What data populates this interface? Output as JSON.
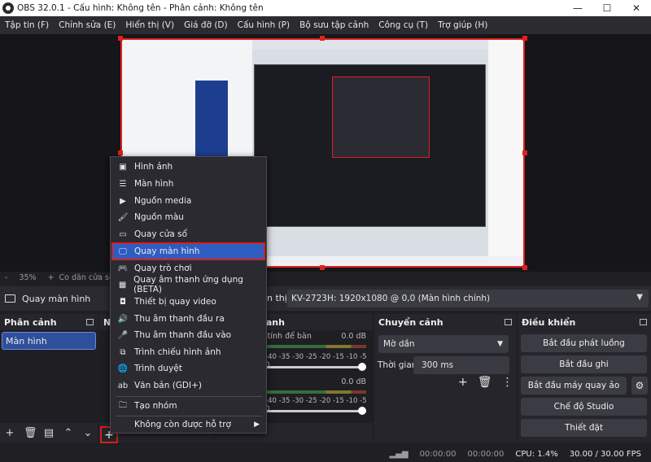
{
  "window": {
    "title": "OBS 32.0.1 - Cấu hình: Không tên - Phân cảnh: Không tên",
    "minimize": "—",
    "maximize": "☐",
    "close": "✕"
  },
  "menu": [
    "Tập tin (F)",
    "Chỉnh sửa (E)",
    "Hiển thị (V)",
    "Giá đỡ (D)",
    "Cấu hình (P)",
    "Bộ sưu tập cảnh",
    "Công cụ (T)",
    "Trợ giúp (H)"
  ],
  "preview": {
    "zoom_minus": "-",
    "zoom": "35%",
    "zoom_plus": "+",
    "scale_label": "Co dãn cửa sổ"
  },
  "properties_bar": {
    "source_name": "Quay màn hình",
    "display_label": "n thị",
    "display_value": "KV-2723H: 1920x1080 @ 0,0 (Màn hình chính)"
  },
  "scenes": {
    "title": "Phân cảnh",
    "items": [
      "Màn hình"
    ]
  },
  "sources": {
    "title_partial": "N"
  },
  "mixer": {
    "title_partial": "hanh",
    "track1_name": "y tính để bàn",
    "track1_db": "0.0 dB",
    "track2_db": "0.0 dB",
    "scale": "-40 -35 -30 -25 -20 -15 -10 -5 0"
  },
  "transitions": {
    "title": "Chuyển cảnh",
    "selected": "Mờ dần",
    "duration_label": "Thời gian",
    "duration_value": "300 ms"
  },
  "controls": {
    "title": "Điều khiển",
    "buttons": [
      "Bắt đầu phát luồng",
      "Bắt đầu ghi",
      "Bắt đầu máy quay ảo",
      "Chế độ Studio",
      "Thiết đặt"
    ]
  },
  "context_menu": {
    "items": [
      {
        "label": "Hình ảnh",
        "icon": "image-icon"
      },
      {
        "label": "Màn hình",
        "icon": "list-icon"
      },
      {
        "label": "Nguồn media",
        "icon": "play-icon"
      },
      {
        "label": "Nguồn màu",
        "icon": "brush-icon"
      },
      {
        "label": "Quay cửa sổ",
        "icon": "window-icon"
      },
      {
        "label": "Quay màn hình",
        "icon": "monitor-icon",
        "selected": true
      },
      {
        "label": "Quay trò chơi",
        "icon": "gamepad-icon"
      },
      {
        "label": "Quay âm thanh ứng dụng (BETA)",
        "icon": "app-audio-icon"
      },
      {
        "label": "Thiết bị quay video",
        "icon": "camera-icon"
      },
      {
        "label": "Thu âm thanh đầu ra",
        "icon": "speaker-icon"
      },
      {
        "label": "Thu âm thanh đầu vào",
        "icon": "microphone-icon"
      },
      {
        "label": "Trình chiếu hình ảnh",
        "icon": "slideshow-icon"
      },
      {
        "label": "Trình duyệt",
        "icon": "globe-icon"
      },
      {
        "label": "Văn bản (GDI+)",
        "icon": "text-icon"
      }
    ],
    "group_label": "Tạo nhóm",
    "unsupported_label": "Không còn được hỗ trợ",
    "accent": "#2e5dc2",
    "highlight": "#d81e1e"
  },
  "status": {
    "record_time": "00:00:00",
    "stream_time": "00:00:00",
    "cpu": "CPU: 1.4%",
    "fps": "30.00 / 30.00 FPS"
  }
}
